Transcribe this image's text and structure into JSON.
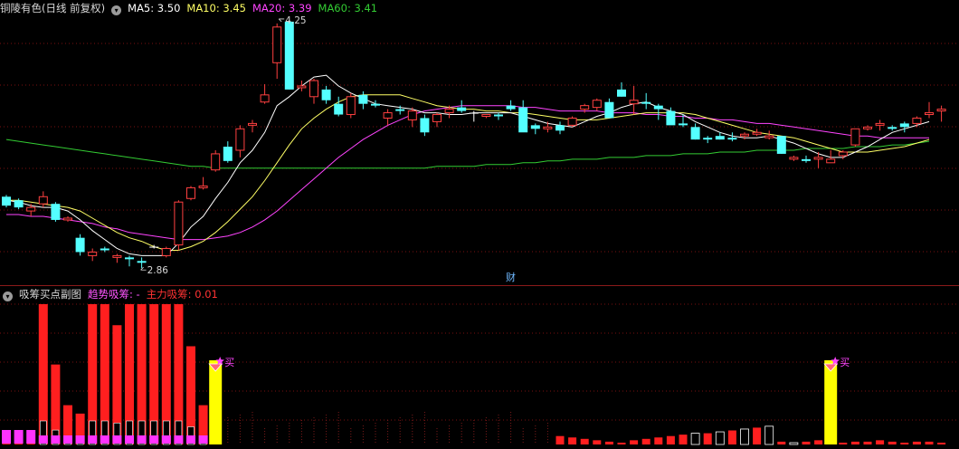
{
  "colors": {
    "bg": "#000000",
    "grid": "#7a1010",
    "up": "#ff4040",
    "down": "#54ffff",
    "doji": "#ffffff",
    "ma5": "#ffffff",
    "ma10": "#ffff66",
    "ma20": "#ff44ff",
    "ma60": "#33cc33",
    "bar_red": "#ff1f1f",
    "bar_yellow": "#ffff00",
    "bar_magenta": "#ff33ff",
    "bar_dark": "#000000",
    "title": "#d8d8d8",
    "trend_label": "#ff55ff",
    "main_label": "#ff3333",
    "badge": "#6fb8ff",
    "buy_marker": "#ff44ff"
  },
  "main_panel": {
    "title": "铜陵有色(日线 前复权)",
    "ma5_label": "MA5: 3.50",
    "ma10_label": "MA10: 3.45",
    "ma20_label": "MA20: 3.39",
    "ma60_label": "MA60: 3.41",
    "high_label": "4.25",
    "low_label": "2.86",
    "badge": "财"
  },
  "sub_panel": {
    "title": "吸筹买点副图",
    "trend_label": "趋势吸筹: -",
    "main_label": "主力吸筹: 0.01",
    "buy_label": "买"
  },
  "chart_data": [
    {
      "type": "candlestick",
      "title": "铜陵有色(日线 前复权)",
      "ylim": [
        2.78,
        4.27
      ],
      "high_annotation": 4.25,
      "low_annotation": 2.86,
      "grid": true,
      "candles": [
        [
          3.26,
          3.27,
          3.2,
          3.21
        ],
        [
          3.24,
          3.25,
          3.19,
          3.2
        ],
        [
          3.18,
          3.22,
          3.15,
          3.2
        ],
        [
          3.22,
          3.29,
          3.2,
          3.26
        ],
        [
          3.22,
          3.23,
          3.12,
          3.13
        ],
        [
          3.13,
          3.15,
          3.12,
          3.14
        ],
        [
          3.03,
          3.05,
          2.93,
          2.95
        ],
        [
          2.93,
          2.97,
          2.9,
          2.95
        ],
        [
          2.97,
          2.98,
          2.95,
          2.96
        ],
        [
          2.92,
          2.94,
          2.89,
          2.93
        ],
        [
          2.92,
          2.93,
          2.87,
          2.91
        ],
        [
          2.9,
          2.92,
          2.86,
          2.89
        ],
        [
          2.98,
          2.99,
          2.97,
          2.98
        ],
        [
          2.93,
          2.98,
          2.92,
          2.97
        ],
        [
          2.99,
          3.24,
          2.96,
          3.23
        ],
        [
          3.25,
          3.32,
          3.24,
          3.31
        ],
        [
          3.31,
          3.37,
          3.3,
          3.32
        ],
        [
          3.41,
          3.52,
          3.4,
          3.5
        ],
        [
          3.54,
          3.57,
          3.45,
          3.46
        ],
        [
          3.52,
          3.66,
          3.48,
          3.64
        ],
        [
          3.66,
          3.69,
          3.62,
          3.67
        ],
        [
          3.79,
          3.89,
          3.78,
          3.83
        ],
        [
          4.01,
          4.23,
          3.92,
          4.21
        ],
        [
          4.24,
          4.25,
          3.86,
          3.86
        ],
        [
          3.87,
          3.91,
          3.85,
          3.88
        ],
        [
          3.82,
          3.92,
          3.78,
          3.91
        ],
        [
          3.86,
          3.88,
          3.78,
          3.8
        ],
        [
          3.78,
          3.82,
          3.71,
          3.72
        ],
        [
          3.72,
          3.84,
          3.7,
          3.82
        ],
        [
          3.83,
          3.85,
          3.75,
          3.78
        ],
        [
          3.78,
          3.8,
          3.76,
          3.77
        ],
        [
          3.7,
          3.75,
          3.66,
          3.73
        ],
        [
          3.75,
          3.77,
          3.72,
          3.74
        ],
        [
          3.69,
          3.76,
          3.65,
          3.74
        ],
        [
          3.7,
          3.72,
          3.6,
          3.62
        ],
        [
          3.68,
          3.73,
          3.65,
          3.72
        ],
        [
          3.73,
          3.77,
          3.7,
          3.75
        ],
        [
          3.76,
          3.8,
          3.73,
          3.74
        ],
        [
          3.73,
          3.74,
          3.68,
          3.73
        ],
        [
          3.71,
          3.72,
          3.7,
          3.72
        ],
        [
          3.72,
          3.73,
          3.69,
          3.71
        ],
        [
          3.77,
          3.8,
          3.74,
          3.75
        ],
        [
          3.76,
          3.8,
          3.63,
          3.62
        ],
        [
          3.66,
          3.67,
          3.61,
          3.64
        ],
        [
          3.64,
          3.68,
          3.62,
          3.65
        ],
        [
          3.66,
          3.68,
          3.61,
          3.63
        ],
        [
          3.66,
          3.71,
          3.65,
          3.7
        ],
        [
          3.75,
          3.78,
          3.73,
          3.77
        ],
        [
          3.76,
          3.81,
          3.74,
          3.8
        ],
        [
          3.79,
          3.81,
          3.71,
          3.7
        ],
        [
          3.86,
          3.9,
          3.82,
          3.82
        ],
        [
          3.78,
          3.88,
          3.72,
          3.8
        ],
        [
          3.79,
          3.84,
          3.75,
          3.78
        ],
        [
          3.77,
          3.78,
          3.69,
          3.75
        ],
        [
          3.74,
          3.76,
          3.68,
          3.66
        ],
        [
          3.67,
          3.72,
          3.65,
          3.66
        ],
        [
          3.65,
          3.67,
          3.58,
          3.58
        ],
        [
          3.59,
          3.6,
          3.56,
          3.58
        ],
        [
          3.6,
          3.62,
          3.58,
          3.58
        ],
        [
          3.59,
          3.62,
          3.57,
          3.58
        ],
        [
          3.6,
          3.62,
          3.58,
          3.61
        ],
        [
          3.61,
          3.64,
          3.6,
          3.62
        ],
        [
          3.59,
          3.63,
          3.58,
          3.6
        ],
        [
          3.6,
          3.6,
          3.5,
          3.5
        ],
        [
          3.47,
          3.49,
          3.46,
          3.48
        ],
        [
          3.47,
          3.49,
          3.45,
          3.46
        ],
        [
          3.47,
          3.51,
          3.42,
          3.48
        ],
        [
          3.45,
          3.52,
          3.46,
          3.47
        ],
        [
          3.49,
          3.52,
          3.47,
          3.51
        ],
        [
          3.55,
          3.64,
          3.54,
          3.64
        ],
        [
          3.64,
          3.66,
          3.63,
          3.65
        ],
        [
          3.66,
          3.69,
          3.63,
          3.67
        ],
        [
          3.65,
          3.66,
          3.63,
          3.64
        ],
        [
          3.67,
          3.68,
          3.62,
          3.65
        ],
        [
          3.67,
          3.71,
          3.65,
          3.7
        ],
        [
          3.72,
          3.79,
          3.7,
          3.73
        ],
        [
          3.74,
          3.77,
          3.68,
          3.75
        ]
      ],
      "ma_series": [
        {
          "name": "MA5",
          "label": "MA5: 3.50",
          "values": [
            3.24,
            3.23,
            3.21,
            3.2,
            3.2,
            3.18,
            3.13,
            3.07,
            3.02,
            2.97,
            2.94,
            2.93,
            2.93,
            2.93,
            3.0,
            3.09,
            3.15,
            3.25,
            3.34,
            3.45,
            3.52,
            3.62,
            3.77,
            3.82,
            3.88,
            3.93,
            3.94,
            3.88,
            3.84,
            3.81,
            3.78,
            3.77,
            3.76,
            3.75,
            3.73,
            3.73,
            3.72,
            3.72,
            3.73,
            3.73,
            3.73,
            3.73,
            3.71,
            3.69,
            3.67,
            3.66,
            3.65,
            3.68,
            3.71,
            3.73,
            3.76,
            3.78,
            3.79,
            3.76,
            3.74,
            3.72,
            3.68,
            3.65,
            3.62,
            3.6,
            3.59,
            3.59,
            3.6,
            3.58,
            3.56,
            3.53,
            3.5,
            3.48,
            3.48,
            3.51,
            3.54,
            3.58,
            3.62,
            3.64,
            3.66,
            3.68,
            3.5
          ]
        },
        {
          "name": "MA10",
          "label": "MA10: 3.45",
          "values": [
            3.24,
            3.24,
            3.23,
            3.22,
            3.21,
            3.2,
            3.18,
            3.14,
            3.1,
            3.06,
            3.03,
            3.01,
            2.98,
            2.96,
            2.96,
            2.98,
            3.01,
            3.06,
            3.12,
            3.19,
            3.26,
            3.35,
            3.45,
            3.55,
            3.64,
            3.7,
            3.75,
            3.79,
            3.82,
            3.83,
            3.83,
            3.83,
            3.83,
            3.81,
            3.79,
            3.77,
            3.76,
            3.75,
            3.75,
            3.74,
            3.74,
            3.73,
            3.73,
            3.72,
            3.71,
            3.7,
            3.69,
            3.69,
            3.69,
            3.7,
            3.71,
            3.72,
            3.73,
            3.73,
            3.73,
            3.73,
            3.72,
            3.7,
            3.68,
            3.66,
            3.64,
            3.62,
            3.61,
            3.6,
            3.59,
            3.57,
            3.55,
            3.53,
            3.51,
            3.51,
            3.51,
            3.52,
            3.53,
            3.54,
            3.56,
            3.58,
            3.45
          ]
        },
        {
          "name": "MA20",
          "label": "MA20: 3.39",
          "values": [
            3.16,
            3.16,
            3.15,
            3.15,
            3.14,
            3.13,
            3.12,
            3.11,
            3.09,
            3.08,
            3.06,
            3.05,
            3.04,
            3.03,
            3.02,
            3.02,
            3.02,
            3.03,
            3.04,
            3.06,
            3.09,
            3.13,
            3.18,
            3.24,
            3.3,
            3.36,
            3.42,
            3.48,
            3.53,
            3.58,
            3.62,
            3.66,
            3.69,
            3.72,
            3.74,
            3.75,
            3.76,
            3.77,
            3.77,
            3.77,
            3.77,
            3.77,
            3.76,
            3.76,
            3.75,
            3.74,
            3.74,
            3.74,
            3.74,
            3.73,
            3.73,
            3.73,
            3.72,
            3.72,
            3.71,
            3.71,
            3.7,
            3.7,
            3.69,
            3.69,
            3.68,
            3.67,
            3.67,
            3.66,
            3.65,
            3.64,
            3.63,
            3.62,
            3.61,
            3.6,
            3.6,
            3.59,
            3.59,
            3.59,
            3.59,
            3.59,
            3.39
          ]
        },
        {
          "name": "MA60",
          "label": "MA60: 3.41",
          "values": [
            3.58,
            3.57,
            3.56,
            3.55,
            3.54,
            3.53,
            3.52,
            3.51,
            3.5,
            3.49,
            3.48,
            3.47,
            3.46,
            3.45,
            3.44,
            3.43,
            3.43,
            3.42,
            3.42,
            3.42,
            3.42,
            3.42,
            3.42,
            3.42,
            3.42,
            3.42,
            3.42,
            3.42,
            3.42,
            3.42,
            3.42,
            3.42,
            3.42,
            3.42,
            3.42,
            3.43,
            3.43,
            3.43,
            3.43,
            3.44,
            3.44,
            3.44,
            3.45,
            3.45,
            3.46,
            3.46,
            3.47,
            3.47,
            3.47,
            3.48,
            3.48,
            3.48,
            3.49,
            3.49,
            3.49,
            3.5,
            3.5,
            3.5,
            3.51,
            3.51,
            3.51,
            3.52,
            3.52,
            3.52,
            3.52,
            3.53,
            3.53,
            3.53,
            3.53,
            3.54,
            3.54,
            3.54,
            3.55,
            3.55,
            3.56,
            3.57,
            3.41
          ]
        }
      ]
    },
    {
      "type": "bar",
      "title": "吸筹买点副图",
      "series": [
        {
          "name": "主力吸筹",
          "values": [
            0.1,
            0.1,
            0.1,
            1.0,
            0.57,
            0.28,
            0.22,
            1.0,
            1.0,
            0.85,
            1.0,
            1.0,
            1.0,
            1.0,
            1.0,
            0.7,
            0.28,
            0,
            0,
            0,
            0,
            0,
            0,
            0,
            0,
            0,
            0,
            0,
            0,
            0,
            0,
            0,
            0,
            0,
            0,
            0,
            0,
            0,
            0,
            0,
            0,
            0,
            0,
            0,
            0,
            0.06,
            0.05,
            0.04,
            0.03,
            0.02,
            0.01,
            0.03,
            0.04,
            0.05,
            0.06,
            0.07,
            0.08,
            0.08,
            0.09,
            0.1,
            0.11,
            0.12,
            0.13,
            0.02,
            0.01,
            0.02,
            0.03,
            0.02,
            0.01,
            0.02,
            0.02,
            0.03,
            0.02,
            0.01,
            0.02,
            0.02,
            0.01
          ]
        },
        {
          "name": "趋势吸筹",
          "values": [
            0,
            0,
            0,
            0,
            0,
            0,
            0,
            0,
            0,
            0,
            0,
            0,
            0,
            0,
            0,
            0,
            0,
            0.6,
            0,
            0,
            0,
            0,
            0,
            0,
            0,
            0,
            0,
            0,
            0,
            0,
            0,
            0,
            0,
            0,
            0,
            0,
            0,
            0,
            0,
            0,
            0,
            0,
            0,
            0,
            0,
            0,
            0,
            0,
            0,
            0,
            0,
            0,
            0,
            0,
            0,
            0,
            0,
            0,
            0,
            0,
            0,
            0,
            0,
            0,
            0,
            0,
            0,
            0.6,
            0,
            0,
            0,
            0,
            0,
            0,
            0,
            0,
            0
          ]
        }
      ]
    }
  ]
}
